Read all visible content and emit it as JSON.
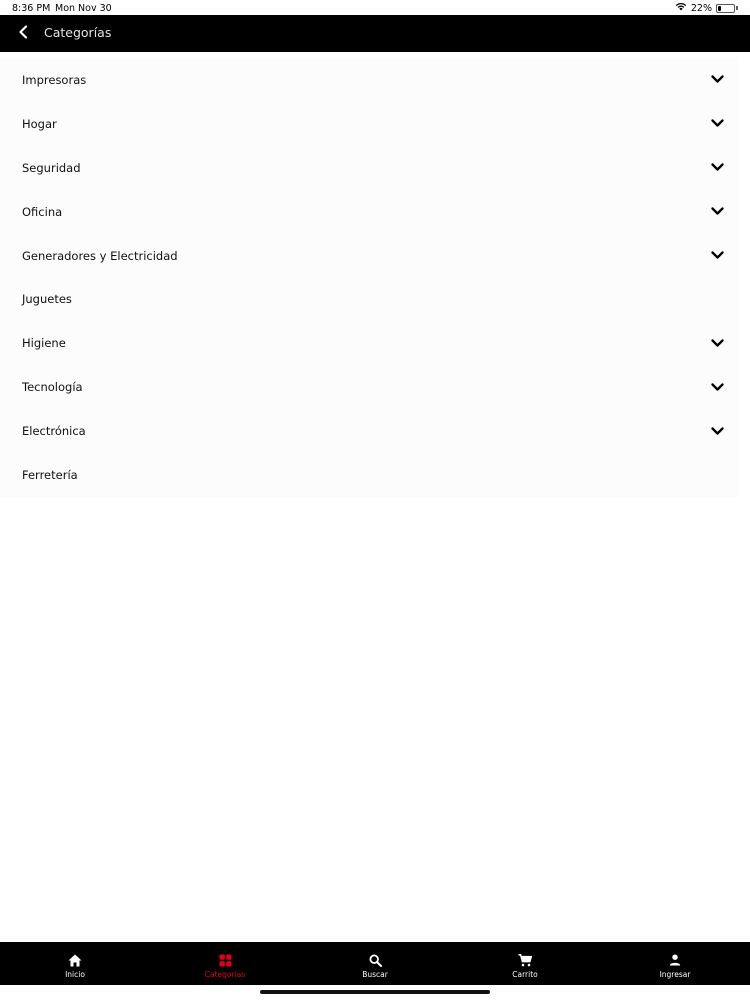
{
  "status_bar": {
    "time": "8:36 PM",
    "date": "Mon Nov 30",
    "battery": "22%",
    "battery_level": 0.22
  },
  "nav": {
    "title": "Categorías",
    "back_icon": "chevron-left-icon"
  },
  "categories": [
    {
      "label": "Impresoras",
      "expandable": true
    },
    {
      "label": "Hogar",
      "expandable": true
    },
    {
      "label": "Seguridad",
      "expandable": true
    },
    {
      "label": "Oficina",
      "expandable": true
    },
    {
      "label": "Generadores y Electricidad",
      "expandable": true
    },
    {
      "label": "Juguetes",
      "expandable": false
    },
    {
      "label": "Higiene",
      "expandable": true
    },
    {
      "label": "Tecnología",
      "expandable": true
    },
    {
      "label": "Electrónica",
      "expandable": true
    },
    {
      "label": "Ferretería",
      "expandable": false
    }
  ],
  "tabs": [
    {
      "label": "Inicio",
      "icon": "home-icon",
      "active": false
    },
    {
      "label": "Categorías",
      "icon": "grid-icon",
      "active": true
    },
    {
      "label": "Buscar",
      "icon": "search-icon",
      "active": false
    },
    {
      "label": "Carrito",
      "icon": "cart-icon",
      "active": false
    },
    {
      "label": "Ingresar",
      "icon": "user-icon",
      "active": false
    }
  ],
  "colors": {
    "accent": "#e0001b",
    "bar_background": "#000000",
    "list_background": "#fcfcfd"
  }
}
